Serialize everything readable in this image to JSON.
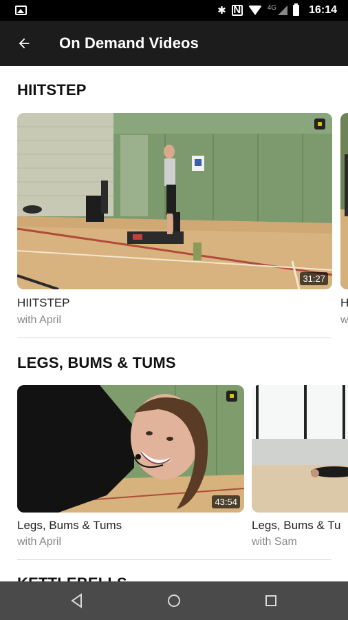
{
  "status_bar": {
    "time": "16:14",
    "network": "4G",
    "icons": [
      "image-icon",
      "bluetooth-icon",
      "nfc-icon",
      "wifi-icon",
      "signal-icon",
      "battery-icon"
    ]
  },
  "app_bar": {
    "title": "On Demand Videos",
    "back_icon": "arrow-left-icon"
  },
  "sections": [
    {
      "title": "HIITSTEP",
      "videos": [
        {
          "title": "HIITSTEP",
          "instructor": "with April",
          "duration": "31:27"
        },
        {
          "title": "H",
          "instructor": "w",
          "duration": ""
        }
      ]
    },
    {
      "title": "LEGS, BUMS & TUMS",
      "videos": [
        {
          "title": "Legs, Bums & Tums",
          "instructor": "with April",
          "duration": "43:54"
        },
        {
          "title": "Legs, Bums & Tu",
          "instructor": "with Sam",
          "duration": ""
        }
      ]
    },
    {
      "title": "KETTLEBELLS",
      "videos": []
    }
  ],
  "nav_bar": {
    "icons": [
      "nav-back-icon",
      "nav-home-icon",
      "nav-recents-icon"
    ]
  }
}
